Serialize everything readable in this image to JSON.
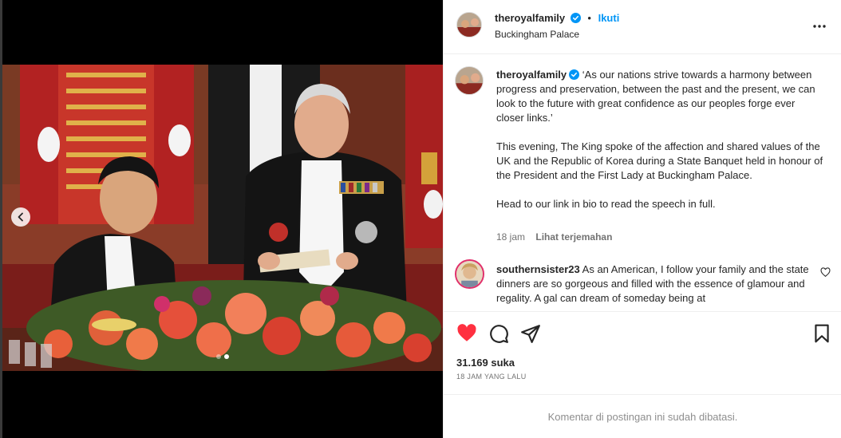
{
  "post": {
    "username": "theroyalfamily",
    "separator": "•",
    "follow_label": "Ikuti",
    "location": "Buckingham Palace"
  },
  "caption": {
    "username": "theroyalfamily",
    "paragraphs": [
      "‘As our nations strive towards a harmony between progress and preservation, between the past and the present, we can look to the future with great confidence as our peoples forge ever closer links.’",
      "This evening, The King spoke of the affection and shared values of the UK and the Republic of Korea during a State Banquet held in honour of the President and the First Lady at Buckingham Palace.",
      "Head to our link in bio to read the speech in full."
    ],
    "time": "18 jam",
    "translate_label": "Lihat terjemahan"
  },
  "comment": {
    "username": "southernsister23",
    "text": "As an American, I follow your family and the state dinners are so gorgeous and filled with the essence of glamour and regality. A gal can dream of someday being at"
  },
  "actions": {
    "likes": "31.169 suka",
    "time_ago": "18 JAM YANG LALU"
  },
  "footer": {
    "comments_disabled": "Komentar di postingan ini sudah dibatasi."
  },
  "carousel": {
    "slide_count": 2,
    "current_slide": 1
  },
  "icons": {
    "like": "heart-filled-icon",
    "comment": "comment-icon",
    "share": "share-icon",
    "save": "bookmark-icon",
    "more": "more-options-icon",
    "verified": "verified-badge-icon",
    "prev": "chevron-left-icon"
  },
  "colors": {
    "like_red": "#ff3040",
    "link_blue": "#0095f6",
    "verified_blue": "#0095f6",
    "secondary_text": "#737373"
  }
}
